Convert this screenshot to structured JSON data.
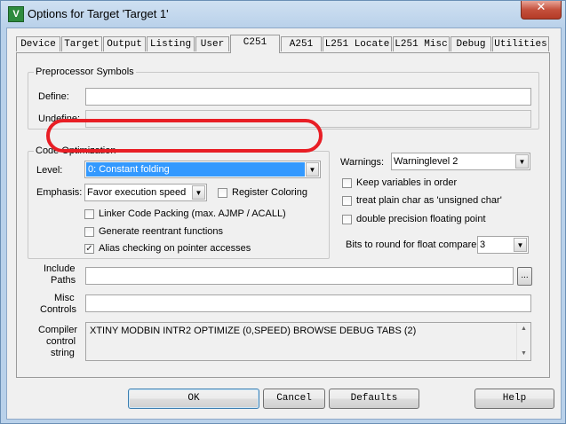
{
  "window": {
    "title": "Options for Target 'Target 1'",
    "close_glyph": "✕",
    "app_icon": "µVision-icon"
  },
  "tabs": [
    {
      "label": "Device"
    },
    {
      "label": "Target"
    },
    {
      "label": "Output"
    },
    {
      "label": "Listing"
    },
    {
      "label": "User"
    },
    {
      "label": "C251",
      "active": true
    },
    {
      "label": "A251"
    },
    {
      "label": "L251 Locate"
    },
    {
      "label": "L251 Misc"
    },
    {
      "label": "Debug"
    },
    {
      "label": "Utilities"
    }
  ],
  "preprocessor": {
    "legend": "Preprocessor Symbols",
    "define_label": "Define:",
    "define_value": "",
    "undefine_label": "Undefine:",
    "undefine_value": ""
  },
  "optimization": {
    "legend": "Code Optimization",
    "level_label": "Level:",
    "level_value": "0: Constant folding",
    "emphasis_label": "Emphasis:",
    "emphasis_value": "Favor execution speed",
    "register_coloring": {
      "label": "Register Coloring",
      "checked": false
    },
    "linker_packing": {
      "label": "Linker Code Packing (max. AJMP / ACALL)",
      "checked": false
    },
    "reentrant": {
      "label": "Generate reentrant functions",
      "checked": false
    },
    "alias_checking": {
      "label": "Alias checking on pointer accesses",
      "checked": true
    }
  },
  "warnings": {
    "label": "Warnings:",
    "value": "Warninglevel 2"
  },
  "options": {
    "keep_variables": {
      "label": "Keep variables in order",
      "checked": false
    },
    "plain_char": {
      "label": "treat plain char as 'unsigned char'",
      "checked": false
    },
    "double_precision": {
      "label": "double precision floating point",
      "checked": false
    },
    "bits_round_label": "Bits to round for float compare:",
    "bits_round_value": "3"
  },
  "paths": {
    "include_label_1": "Include",
    "include_label_2": "Paths",
    "include_value": "",
    "browse_label": "...",
    "misc_label_1": "Misc",
    "misc_label_2": "Controls",
    "misc_value": "",
    "compiler_label_1": "Compiler",
    "compiler_label_2": "control",
    "compiler_label_3": "string",
    "compiler_string": "XTINY MODBIN INTR2 OPTIMIZE (0,SPEED) BROWSE DEBUG TABS (2)"
  },
  "buttons": {
    "ok": "OK",
    "cancel": "Cancel",
    "defaults": "Defaults",
    "help": "Help"
  },
  "colors": {
    "highlight": "#3399ff",
    "annotation_ring": "#e81e25"
  }
}
